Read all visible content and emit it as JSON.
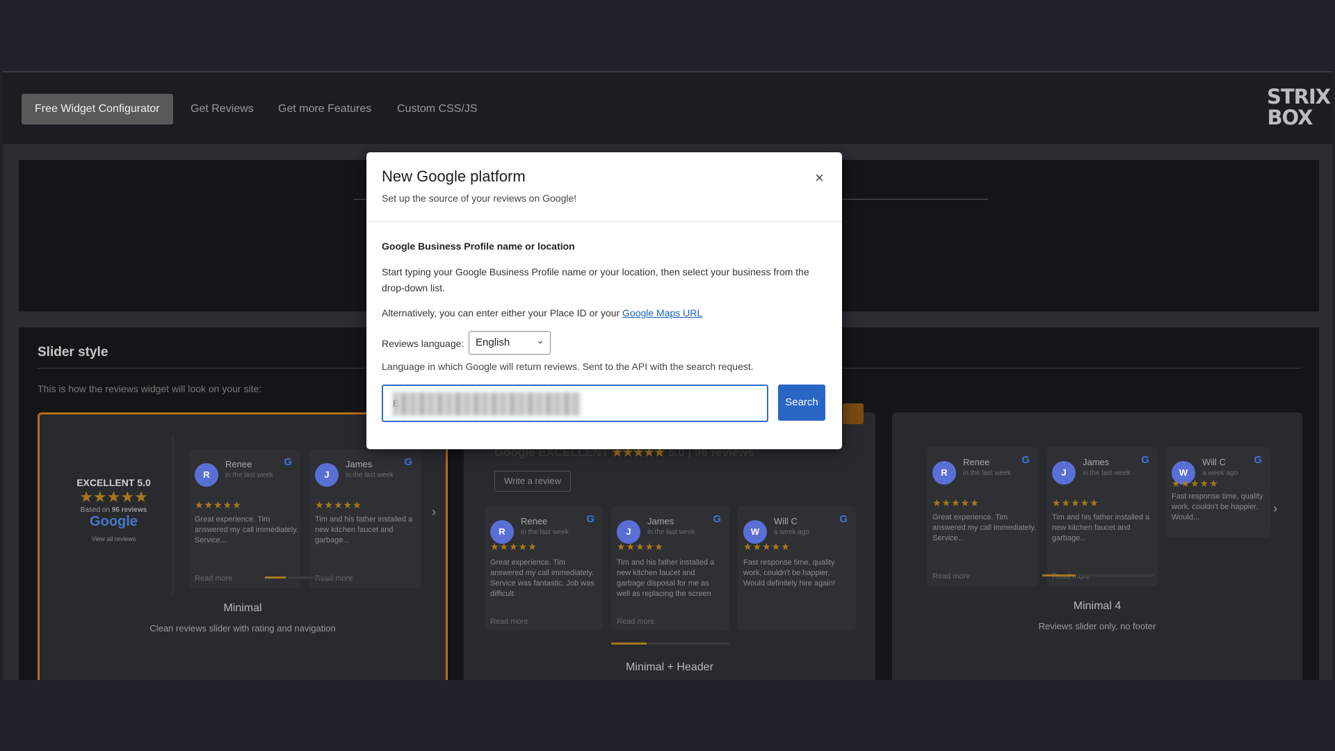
{
  "nav": {
    "tabs": [
      "Free Widget Configurator",
      "Get Reviews",
      "Get more Features",
      "Custom CSS/JS"
    ],
    "logo": "STRIX BOX"
  },
  "slider": {
    "title": "Slider style",
    "description": "This is how the reviews widget will look on your site:",
    "cards": [
      {
        "title": "Minimal",
        "description": "Clean reviews slider with rating and navigation"
      },
      {
        "title": "Minimal + Header",
        "description": ""
      },
      {
        "title": "Minimal 4",
        "description": "Reviews slider only, no footer"
      }
    ],
    "summary": {
      "rating_word": "EXCELLENT",
      "rating": "5.0",
      "stars": "★★★★★",
      "based_prefix": "Based on",
      "based_count": "96 reviews",
      "google": "Google",
      "view_all": "View all reviews"
    },
    "header_c2": {
      "rating_word": "EXCELLENT",
      "rating": "5.0",
      "count": "96 reviews",
      "write": "Write a review"
    },
    "reviews": [
      {
        "initial": "R",
        "name": "Renee",
        "when": "in the last week",
        "text": "Great experience. Tim answered my call immediately. Service...",
        "color": "#5a6fd6"
      },
      {
        "initial": "J",
        "name": "James",
        "when": "in the last week",
        "text": "Tim and his father installed a new kitchen faucet and garbage...",
        "color": "#5a6fd6"
      },
      {
        "initial": "W",
        "name": "Will C",
        "when": "a week ago",
        "text": "Fast response time, quality work, couldn't be happier. Would...",
        "color": "#5a6fd6"
      }
    ],
    "reviews_c2": [
      {
        "text": "Great experience. Tim answered my call immediately. Service was fantastic. Job was difficult"
      },
      {
        "text": "Tim and his father installed a new kitchen faucet and garbage disposal for me as well as replacing the screen"
      },
      {
        "text": "Fast response time, quality work, couldn't be happier. Would definitely hire again!"
      }
    ],
    "read_more": "Read more",
    "stars": "★★★★★",
    "g": "G"
  },
  "modal": {
    "title": "New Google platform",
    "subtitle": "Set up the source of your reviews on Google!",
    "close": "×",
    "field_label": "Google Business Profile name or location",
    "para1": "Start typing your Google Business Profile name or your location, then select your business from the drop-down list.",
    "para2_prefix": "Alternatively, you can enter either your Place ID or your",
    "para2_link": "Google Maps URL",
    "language_label": "Reviews language:",
    "language_value": "English",
    "language_help": "Language in which Google will return reviews. Sent to the API with the search request.",
    "search_value": "B",
    "search_button": "Search"
  },
  "colors": {
    "accent": "#2a66c3",
    "star": "#a8781f",
    "selected_border": "#b76d1a"
  }
}
